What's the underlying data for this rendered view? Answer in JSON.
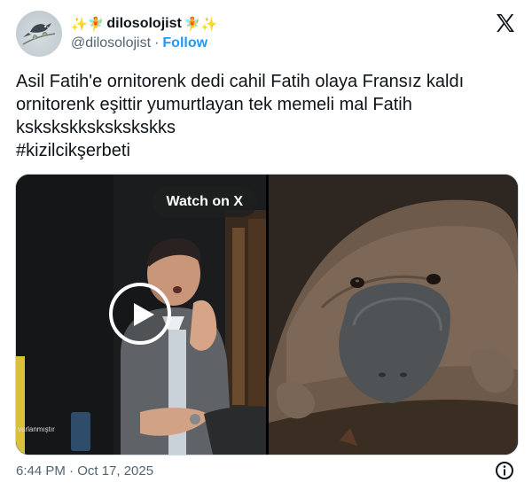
{
  "header": {
    "display_name": "dilosolojist",
    "name_emojis_left": "✨🧚",
    "name_emojis_right": "🧚✨",
    "handle": "@dilosolojist",
    "separator": "·",
    "follow_label": "Follow",
    "avatar_icon": "bird-branch-avatar",
    "logo_icon": "x-logo-icon"
  },
  "tweet": {
    "lines": [
      "Asil Fatih'e ornitorenk dedi cahil Fatih olaya Fransız kaldı",
      "ornitorenk eşittir yumurtlayan tek memeli mal Fatih",
      "kskskskkskskskskks",
      "#kizilcikşerbeti"
    ]
  },
  "media": {
    "watch_label": "Watch on X",
    "video_caption": "varlanmıştır",
    "play_icon": "play-icon"
  },
  "footer": {
    "timestamp": "6:44 PM · Oct 17, 2025",
    "info_icon": "info-icon"
  },
  "colors": {
    "text": "#0f1419",
    "secondary": "#536471",
    "link": "#1d9bf0",
    "border": "#cfd9de"
  }
}
